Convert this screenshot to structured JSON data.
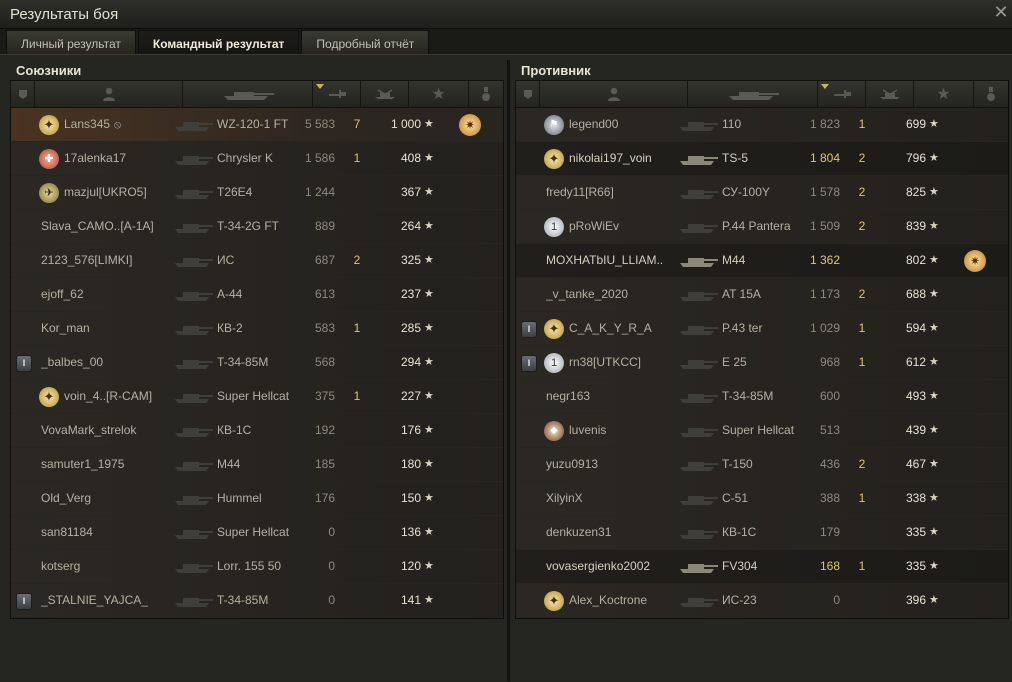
{
  "window": {
    "title": "Результаты боя",
    "close_icon": "close-icon"
  },
  "tabs": [
    {
      "label": "Личный результат",
      "active": false
    },
    {
      "label": "Командный результат",
      "active": true
    },
    {
      "label": "Подробный отчёт",
      "active": false
    }
  ],
  "allies": {
    "title": "Союзники",
    "rows": [
      {
        "name": "Lans345",
        "vehicle": "WZ-120-1 FT",
        "damage": "5 583",
        "kills": "7",
        "xp": "1 000",
        "badge": "b1",
        "medal": true,
        "me": true
      },
      {
        "name": "17alenka17",
        "vehicle": "Chrysler K",
        "damage": "1 586",
        "kills": "1",
        "xp": "408",
        "badge": "b3"
      },
      {
        "name": "mazjul[UKRO5]",
        "vehicle": "T26E4",
        "damage": "1 244",
        "kills": "",
        "xp": "367",
        "badge": "b4"
      },
      {
        "name": "Slava_CAMO..[A-1A]",
        "vehicle": "T-34-2G FT",
        "damage": "889",
        "kills": "",
        "xp": "264"
      },
      {
        "name": "2123_576[LIMKI]",
        "vehicle": "ИС",
        "damage": "687",
        "kills": "2",
        "xp": "325"
      },
      {
        "name": "ejoff_62",
        "vehicle": "A-44",
        "damage": "613",
        "kills": "",
        "xp": "237"
      },
      {
        "name": "Kor_man",
        "vehicle": "КВ-2",
        "damage": "583",
        "kills": "1",
        "xp": "285"
      },
      {
        "name": "_balbes_00",
        "vehicle": "T-34-85M",
        "damage": "568",
        "kills": "",
        "xp": "294",
        "platoon": "I"
      },
      {
        "name": "voin_4..[R-CAM]",
        "vehicle": "Super Hellcat",
        "damage": "375",
        "kills": "1",
        "xp": "227",
        "badge": "b1"
      },
      {
        "name": "VovaMark_strelok",
        "vehicle": "КВ-1С",
        "damage": "192",
        "kills": "",
        "xp": "176"
      },
      {
        "name": "samuter1_1975",
        "vehicle": "M44",
        "damage": "185",
        "kills": "",
        "xp": "180"
      },
      {
        "name": "Old_Verg",
        "vehicle": "Hummel",
        "damage": "176",
        "kills": "",
        "xp": "150"
      },
      {
        "name": "san81184",
        "vehicle": "Super Hellcat",
        "damage": "0",
        "kills": "",
        "xp": "136"
      },
      {
        "name": "kotserg",
        "vehicle": "Lorr. 155 50",
        "damage": "0",
        "kills": "",
        "xp": "120"
      },
      {
        "name": "_STALNIE_YAJCA_",
        "vehicle": "T-34-85M",
        "damage": "0",
        "kills": "",
        "xp": "141",
        "platoon": "I"
      }
    ]
  },
  "enemies": {
    "title": "Противник",
    "rows": [
      {
        "name": "legend00",
        "vehicle": "110",
        "damage": "1 823",
        "kills": "1",
        "xp": "699",
        "badge": "b5"
      },
      {
        "name": "nikolai197_voin",
        "vehicle": "TS-5",
        "damage": "1 804",
        "kills": "2",
        "xp": "796",
        "badge": "b1",
        "gold": true,
        "alive": true
      },
      {
        "name": "fredy11[R66]",
        "vehicle": "СУ-100Y",
        "damage": "1 578",
        "kills": "2",
        "xp": "825"
      },
      {
        "name": "pRoWiEv",
        "vehicle": "P.44 Pantera",
        "damage": "1 509",
        "kills": "2",
        "xp": "839",
        "badge": "b2"
      },
      {
        "name": "MOXHATbIU_LLIAM..",
        "vehicle": "M44",
        "damage": "1 362",
        "kills": "",
        "xp": "802",
        "gold": true,
        "alive": true,
        "medal": true
      },
      {
        "name": "_v_tanke_2020",
        "vehicle": "AT 15A",
        "damage": "1 173",
        "kills": "2",
        "xp": "688"
      },
      {
        "name": "C_A_K_Y_R_A",
        "vehicle": "P.43 ter",
        "damage": "1 029",
        "kills": "1",
        "xp": "594",
        "platoon": "I",
        "badge": "b1"
      },
      {
        "name": "rn38[UTKCC]",
        "vehicle": "E 25",
        "damage": "968",
        "kills": "1",
        "xp": "612",
        "platoon": "I",
        "badge": "b2"
      },
      {
        "name": "negr163",
        "vehicle": "T-34-85M",
        "damage": "600",
        "kills": "",
        "xp": "493"
      },
      {
        "name": "luvenis",
        "vehicle": "Super Hellcat",
        "damage": "513",
        "kills": "",
        "xp": "439",
        "badge": "b6"
      },
      {
        "name": "yuzu0913",
        "vehicle": "T-150",
        "damage": "436",
        "kills": "2",
        "xp": "467"
      },
      {
        "name": "XilyinX",
        "vehicle": "C-51",
        "damage": "388",
        "kills": "1",
        "xp": "338"
      },
      {
        "name": "denkuzen31",
        "vehicle": "КВ-1С",
        "damage": "179",
        "kills": "",
        "xp": "335"
      },
      {
        "name": "vovasergienko2002",
        "vehicle": "FV304",
        "damage": "168",
        "kills": "1",
        "xp": "335",
        "gold": true,
        "alive": true
      },
      {
        "name": "Alex_Koctrone",
        "vehicle": "ИС-23",
        "damage": "0",
        "kills": "",
        "xp": "396",
        "badge": "b1"
      }
    ]
  },
  "colors": {
    "accent": "#e0c66a",
    "highlight_row": "#4a3322"
  }
}
